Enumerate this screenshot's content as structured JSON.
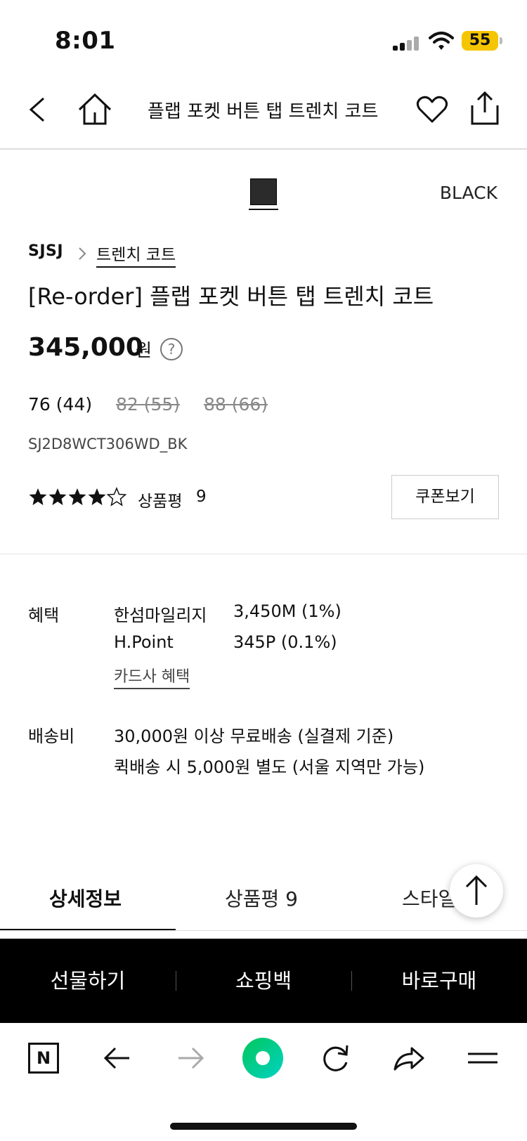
{
  "status_bar": {
    "time": "8:01",
    "battery": "55"
  },
  "header": {
    "title": "플랩 포켓 버튼 탭 트렌치 코트"
  },
  "color": {
    "name": "BLACK",
    "swatch": "#2b2b2b"
  },
  "breadcrumb": {
    "brand": "SJSJ",
    "category": "트렌치 코트"
  },
  "product": {
    "title": "[Re-order] 플랩 포켓 버튼 탭 트렌치 코트",
    "price": "345,000",
    "price_unit": "원",
    "help_glyph": "?",
    "sizes": [
      {
        "label": "76 (44)",
        "available": true
      },
      {
        "label": "82 (55)",
        "available": false
      },
      {
        "label": "88 (66)",
        "available": false
      }
    ],
    "code": "SJ2D8WCT306WD_BK",
    "rating": 4.5,
    "review_label": "상품평",
    "review_count": "9",
    "coupon_label": "쿠폰보기"
  },
  "benefits": {
    "label": "혜택",
    "items": [
      {
        "name": "한섬마일리지",
        "value": "3,450M (1%)"
      },
      {
        "name": "H.Point",
        "value": "345P (0.1%)"
      }
    ],
    "card_link": "카드사 혜택"
  },
  "shipping": {
    "label": "배송비",
    "lines": [
      "30,000원 이상 무료배송 (실결제 기준)",
      "퀵배송 시 5,000원 별도 (서울 지역만 가능)"
    ]
  },
  "tabs": [
    {
      "label": "상세정보",
      "active": true
    },
    {
      "label": "상품평 9",
      "active": false
    },
    {
      "label": "스타일",
      "active": false
    }
  ],
  "actions": {
    "gift": "선물하기",
    "cart": "쇼핑백",
    "buy": "바로구매"
  },
  "browser": {
    "brand_letter": "N",
    "accent": "#03c75a"
  }
}
